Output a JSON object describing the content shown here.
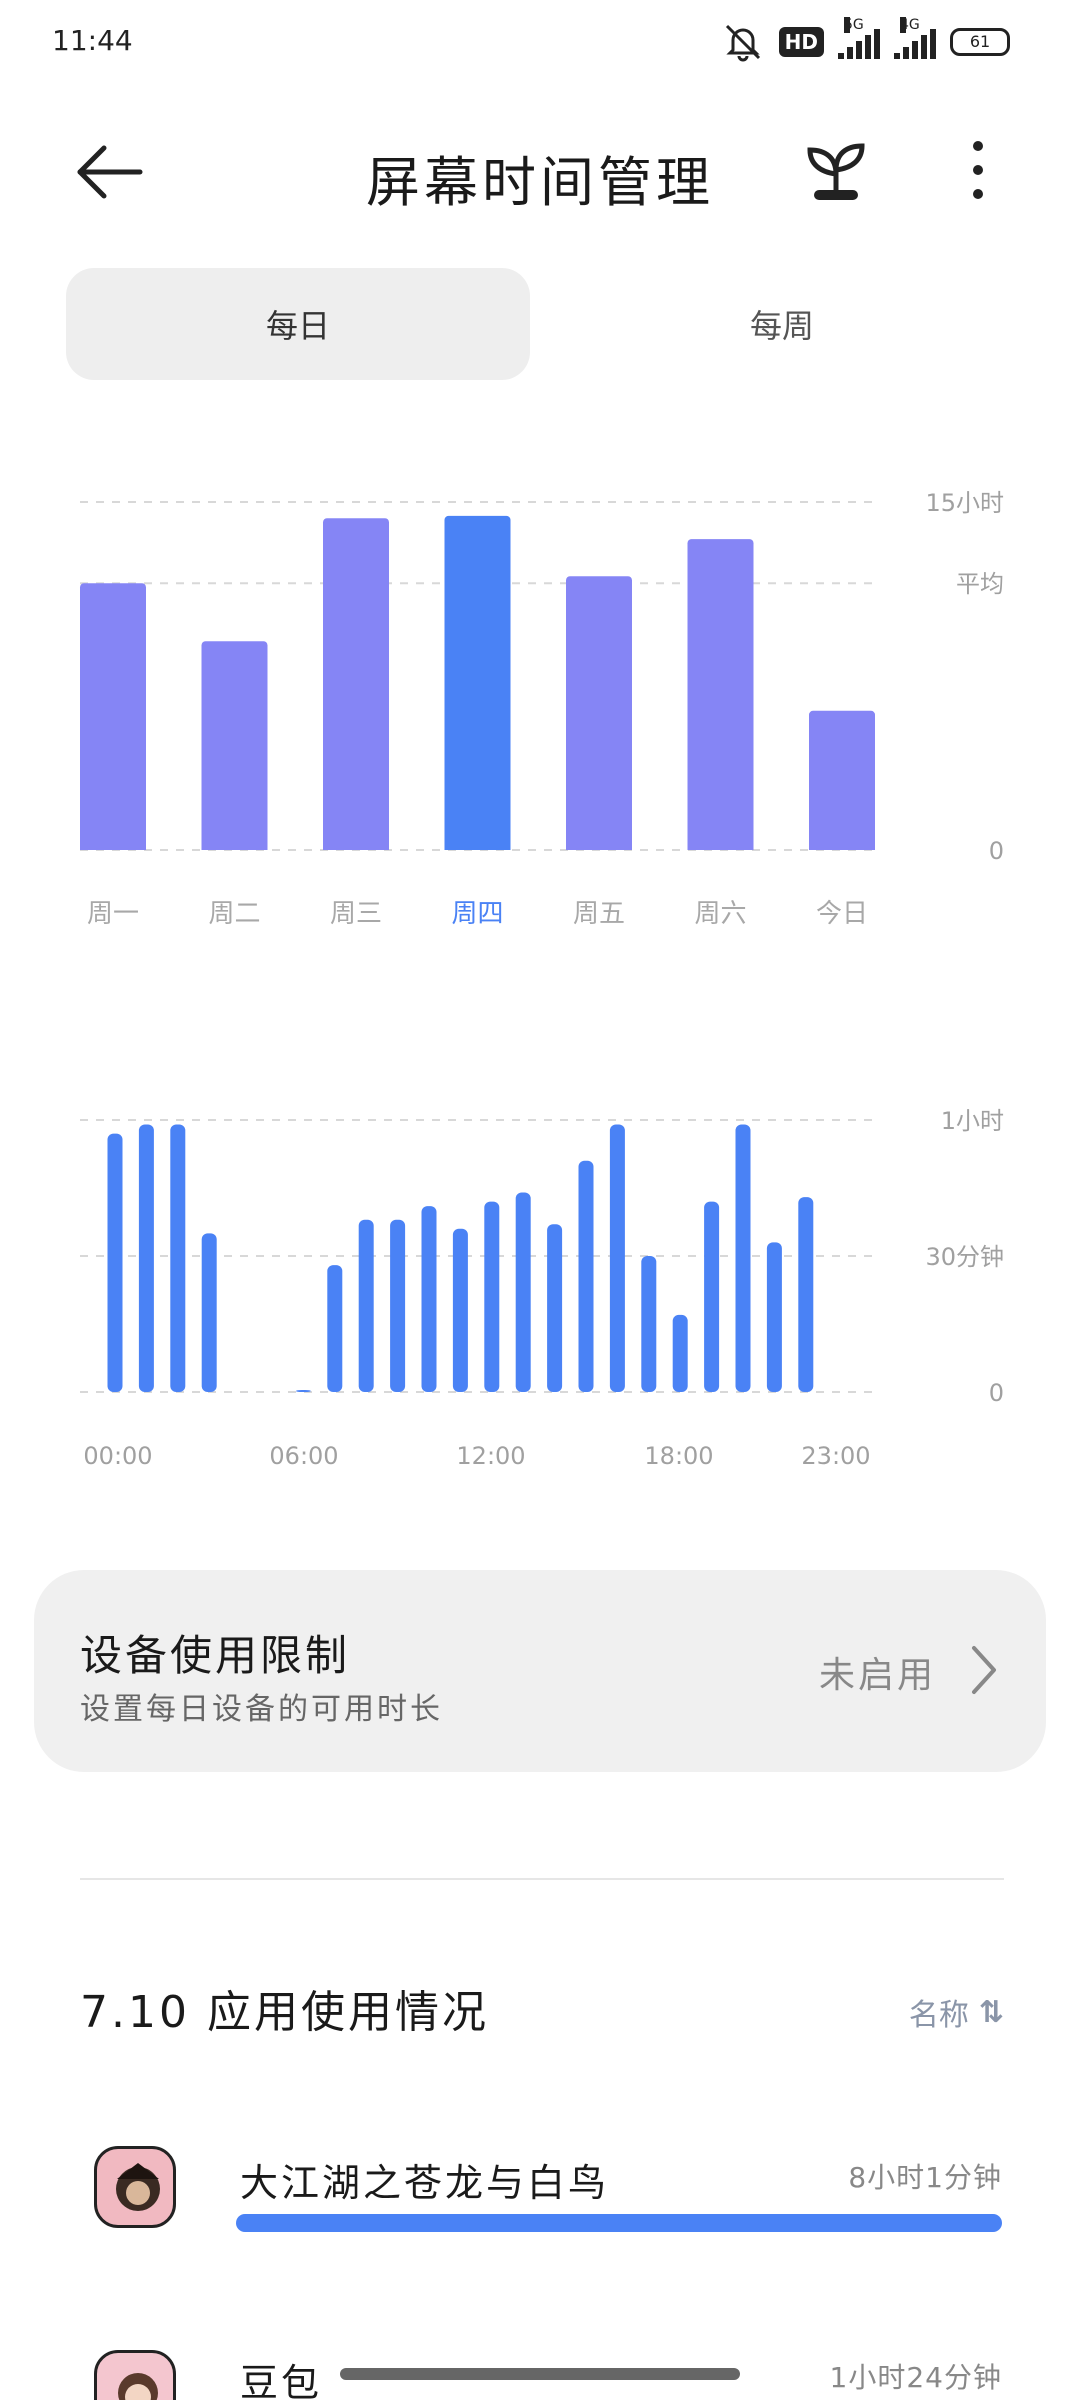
{
  "status_bar": {
    "time": "11:44",
    "hd_label": "HD",
    "net1": "5G",
    "net2": "4G",
    "battery": "61"
  },
  "header": {
    "title": "屏幕时间管理"
  },
  "tabs": [
    {
      "label": "每日",
      "active": true
    },
    {
      "label": "每周",
      "active": false
    }
  ],
  "weekly_chart": {
    "y_top_label": "15小时",
    "avg_label": "平均",
    "y_zero_label": "0",
    "selected_index": 3
  },
  "hourly_chart": {
    "y_top_label": "1小时",
    "y_mid_label": "30分钟",
    "y_zero_label": "0"
  },
  "chart_data": [
    {
      "type": "bar",
      "categories": [
        "周一",
        "周二",
        "周三",
        "周四",
        "周五",
        "周六",
        "今日"
      ],
      "values": [
        11.5,
        9.0,
        14.3,
        14.4,
        11.8,
        13.4,
        6.0
      ],
      "ylim": [
        0,
        15
      ],
      "average": 11.5,
      "highlight": "周四",
      "colors": {
        "default": "#8585f5",
        "highlight": "#4a82f5"
      },
      "grid": true
    },
    {
      "type": "bar",
      "x_tick_labels": [
        "00:00",
        "06:00",
        "12:00",
        "18:00",
        "23:00"
      ],
      "hours": [
        0,
        1,
        2,
        3,
        4,
        5,
        6,
        7,
        8,
        9,
        10,
        11,
        12,
        13,
        14,
        15,
        16,
        17,
        18,
        19,
        20,
        21,
        22,
        23
      ],
      "values_minutes": [
        57,
        59,
        59,
        35,
        0,
        0,
        0.3,
        28,
        38,
        38,
        41,
        36,
        42,
        44,
        37,
        51,
        59,
        30,
        17,
        42,
        59,
        33,
        43,
        null
      ],
      "ylim": [
        0,
        60
      ],
      "color": "#4a82f5",
      "grid": true
    }
  ],
  "device_limit": {
    "title": "设备使用限制",
    "subtitle": "设置每日设备的可用时长",
    "status": "未启用"
  },
  "usage": {
    "header": "7.10 应用使用情况",
    "sort_label": "名称",
    "apps": [
      {
        "name": "大江湖之苍龙与白鸟",
        "time": "8小时1分钟",
        "fraction": 1.0
      },
      {
        "name": "豆包",
        "time": "1小时24分钟",
        "fraction": 0.175
      }
    ]
  }
}
